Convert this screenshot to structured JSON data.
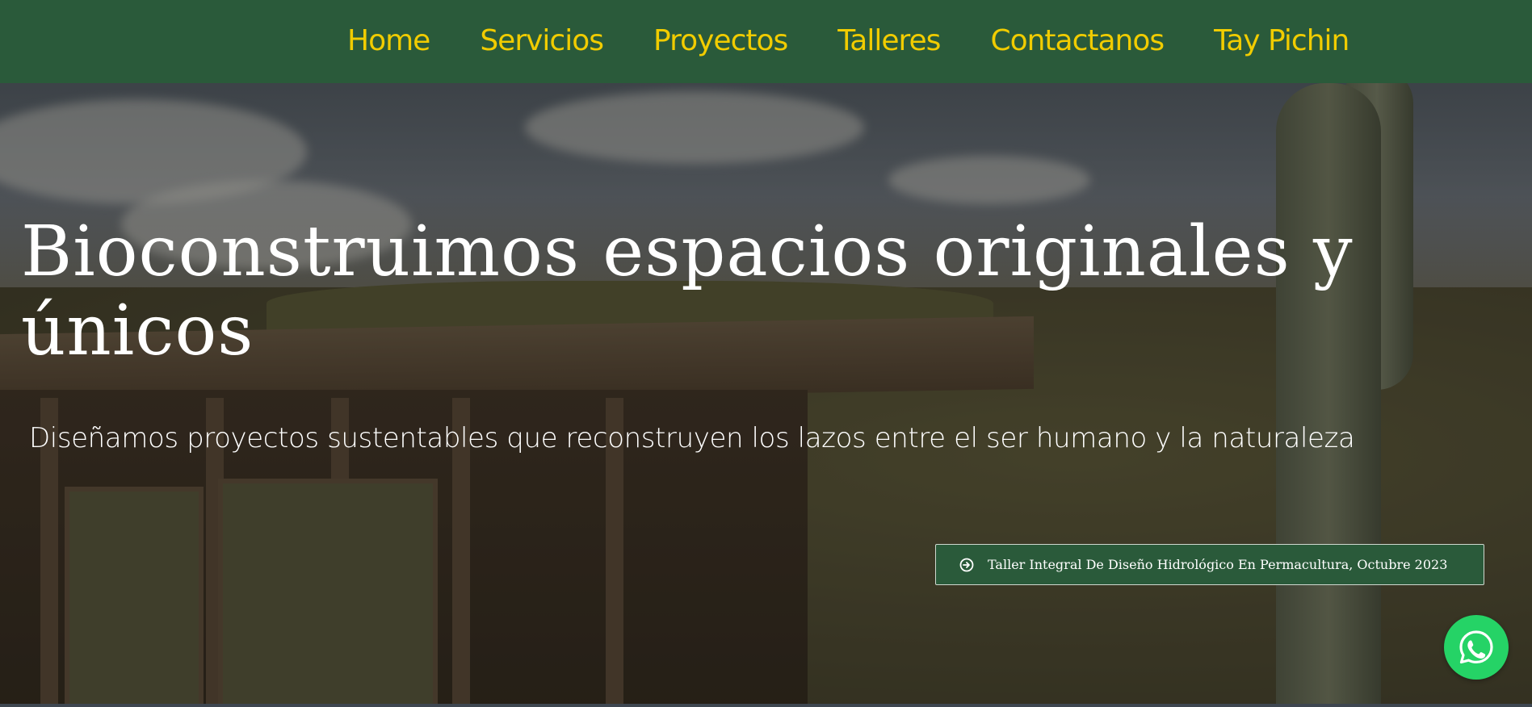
{
  "nav": {
    "items": [
      {
        "label": "Home"
      },
      {
        "label": "Servicios"
      },
      {
        "label": "Proyectos"
      },
      {
        "label": "Talleres"
      },
      {
        "label": "Contactanos"
      },
      {
        "label": "Tay Pichin"
      }
    ]
  },
  "hero": {
    "title": "Bioconstruimos espacios originales y únicos",
    "subtitle": "Diseñamos proyectos sustentables que reconstruyen los lazos entre el ser humano y la naturaleza",
    "cta": {
      "label": "Taller Integral De Diseño Hidrológico En Permacultura, Octubre 2023",
      "icon": "arrow-circle-right-icon"
    }
  },
  "floating": {
    "whatsapp_icon": "whatsapp-icon"
  },
  "colors": {
    "nav_bg": "#2a5a3a",
    "nav_text": "#f1cc00",
    "cta_bg": "#2a5a3a",
    "whatsapp": "#25d366"
  }
}
